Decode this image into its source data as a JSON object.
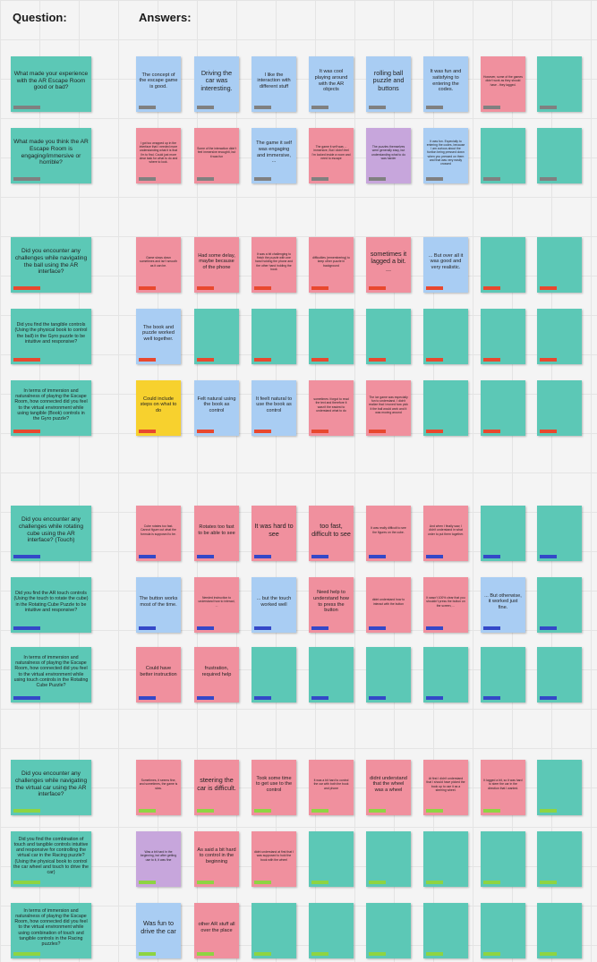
{
  "header": {
    "question": "Question:",
    "answers": "Answers:"
  },
  "rows": [
    {
      "question": "What made your experience with the AR Escape Room good or bad?",
      "qsize": "big",
      "tag": "gray",
      "notes": [
        {
          "c": "blue",
          "t": "The concept of the escape game is good.",
          "s": "m"
        },
        {
          "c": "blue",
          "t": "Driving the car was interesting.",
          "s": "l"
        },
        {
          "c": "blue",
          "t": "I like the interaction with different stuff",
          "s": "m"
        },
        {
          "c": "blue",
          "t": "It was cool playing around with the AR objects",
          "s": "m"
        },
        {
          "c": "blue",
          "t": "rolling ball puzzle and buttons",
          "s": "l"
        },
        {
          "c": "blue",
          "t": "It was fun and satisfying to entering the codes.",
          "s": "m"
        },
        {
          "c": "pink",
          "t": "However, some of the games didn't work as they should have - they lagged.",
          "s": "s"
        },
        {
          "c": "teal",
          "t": "",
          "s": "m"
        }
      ]
    },
    {
      "question": "What made you think the AR Escape Room is engaging/immersive or horrible?",
      "qsize": "big",
      "tag": "gray",
      "notes": [
        {
          "c": "pink",
          "t": "I got too wrapped up in the interface that I needed more understanding what it is that I'm to find. Could just more clear task for what to do and where to look.",
          "s": "s"
        },
        {
          "c": "pink",
          "t": "Some of the interaction didn't feel immersive enoughti, but it was fun",
          "s": "s"
        },
        {
          "c": "blue",
          "t": "The game it self was engaging and immersive, ...",
          "s": "m"
        },
        {
          "c": "pink",
          "t": "The game it self was ... immersive, But I didn't feel I'm locked inside a room and need to escape",
          "s": "s"
        },
        {
          "c": "purple",
          "t": "The puzzles themselves were generally easy, but understanding what to do was harder",
          "s": "s"
        },
        {
          "c": "blue",
          "t": "It was fun. Especially to entering the codes, because I am curious about the funtion being pressed down when you pressed on them and that was very easily crossed",
          "s": "s"
        },
        {
          "c": "teal",
          "t": "",
          "s": "m"
        },
        {
          "c": "teal",
          "t": "",
          "s": "m"
        }
      ]
    },
    {
      "question": "Did you encounter any challenges while navigating the ball using the AR interface?",
      "qsize": "big",
      "tag": "red",
      "notes": [
        {
          "c": "pink",
          "t": "Game slows down sometimes and isn't smooth as it can be.",
          "s": "s"
        },
        {
          "c": "pink",
          "t": "Had some delay, maybe because of the phone",
          "s": "m"
        },
        {
          "c": "pink",
          "t": "It was a bit challenging to finish the puzzle with one hand holding the phone and the other hand holding the book",
          "s": "s"
        },
        {
          "c": "pink",
          "t": "difficulties (remembering) to keep other puzzle in background",
          "s": "s"
        },
        {
          "c": "pink",
          "t": "sometimes it lagged a bit. ...",
          "s": "l"
        },
        {
          "c": "blue",
          "t": "... But over all it was good and very realistic.",
          "s": "m"
        },
        {
          "c": "teal",
          "t": "",
          "s": "m"
        },
        {
          "c": "teal",
          "t": "",
          "s": "m"
        }
      ]
    },
    {
      "question": "Did you find the tangible controls (Using the physical book to control the ball) in the Gyro puzzle to be intuitive and responsive?",
      "qsize": "small",
      "tag": "red",
      "notes": [
        {
          "c": "blue",
          "t": "The book and puzzle worked well together.",
          "s": "m"
        },
        {
          "c": "teal",
          "t": "",
          "s": "m"
        },
        {
          "c": "teal",
          "t": "",
          "s": "m"
        },
        {
          "c": "teal",
          "t": "",
          "s": "m"
        },
        {
          "c": "teal",
          "t": "",
          "s": "m"
        },
        {
          "c": "teal",
          "t": "",
          "s": "m"
        },
        {
          "c": "teal",
          "t": "",
          "s": "m"
        },
        {
          "c": "teal",
          "t": "",
          "s": "m"
        }
      ]
    },
    {
      "question": "In terms of immersion and naturalness of playing the Escape Room, how connected did you feel to the virtual environment while using tangible (Book) controls in the Gyro puzzle?",
      "qsize": "small",
      "tag": "red",
      "notes": [
        {
          "c": "yellow",
          "t": "Could include steps on what to do",
          "s": "m"
        },
        {
          "c": "blue",
          "t": "Felt natural using the book as control",
          "s": "m"
        },
        {
          "c": "blue",
          "t": "It feelt natural to use the book as control",
          "s": "m"
        },
        {
          "c": "pink",
          "t": "sometimes i forgot to read the text and therefore it wasn't the easiest to understand what to do",
          "s": "s"
        },
        {
          "c": "pink",
          "t": "The ice game was especially fun to understand. I didn't realize that I moved how pick it the ball would work and it was moving around",
          "s": "s"
        },
        {
          "c": "teal",
          "t": "",
          "s": "m"
        },
        {
          "c": "teal",
          "t": "",
          "s": "m"
        },
        {
          "c": "teal",
          "t": "",
          "s": "m"
        }
      ]
    },
    {
      "question": "Did you encounter any challenges while rotating cube using the AR interface? (Touch)",
      "qsize": "big",
      "tag": "blue",
      "notes": [
        {
          "c": "pink",
          "t": "Cube rotates too fast. Cannot figure out what the formula is supposed to be.",
          "s": "s"
        },
        {
          "c": "pink",
          "t": "Rotates too fast to be able to see",
          "s": "m"
        },
        {
          "c": "pink",
          "t": "It was hard to see",
          "s": "l"
        },
        {
          "c": "pink",
          "t": "too fast, difficult to see",
          "s": "l"
        },
        {
          "c": "pink",
          "t": "It was really difficult to see the figures on the cube.",
          "s": "s"
        },
        {
          "c": "pink",
          "t": "And when I finally saw, I didn't understand in what order to put them together.",
          "s": "s"
        },
        {
          "c": "teal",
          "t": "",
          "s": "m"
        },
        {
          "c": "teal",
          "t": "",
          "s": "m"
        }
      ]
    },
    {
      "question": "Did you find the AR touch controls (Using the touch to rotate the cube) in the Rotating Cube Puzzle to be intuitive and responsive?",
      "qsize": "small",
      "tag": "blue",
      "notes": [
        {
          "c": "blue",
          "t": "The button works most of the time.",
          "s": "m"
        },
        {
          "c": "pink",
          "t": "Needed instruction to understand how to interact, ...",
          "s": "s"
        },
        {
          "c": "blue",
          "t": "... but the touch worked well",
          "s": "m"
        },
        {
          "c": "pink",
          "t": "Need help to understand how to press the button",
          "s": "m"
        },
        {
          "c": "pink",
          "t": "didnt understand how to interact with the button",
          "s": "s"
        },
        {
          "c": "pink",
          "t": "It wasn't 100% clear that you shouldn't press the button on the screen, ...",
          "s": "s"
        },
        {
          "c": "blue",
          "t": "... But otherwise, it worked just fine.",
          "s": "m"
        },
        {
          "c": "teal",
          "t": "",
          "s": "m"
        }
      ]
    },
    {
      "question": "In terms of immersion and naturalness of playing the Escape Room, how connected did you feel to the virtual environment while using touch controls in the Rotating Cube Puzzle?",
      "qsize": "small",
      "tag": "blue",
      "notes": [
        {
          "c": "pink",
          "t": "Could have better instruction",
          "s": "m"
        },
        {
          "c": "pink",
          "t": "frustration, required help",
          "s": "m"
        },
        {
          "c": "teal",
          "t": "",
          "s": "m"
        },
        {
          "c": "teal",
          "t": "",
          "s": "m"
        },
        {
          "c": "teal",
          "t": "",
          "s": "m"
        },
        {
          "c": "teal",
          "t": "",
          "s": "m"
        },
        {
          "c": "teal",
          "t": "",
          "s": "m"
        },
        {
          "c": "teal",
          "t": "",
          "s": "m"
        }
      ]
    },
    {
      "question": "Did you encounter any challenges while navigating the virtual car using the AR interface?",
      "qsize": "big",
      "tag": "green",
      "notes": [
        {
          "c": "pink",
          "t": "Sometimes, it seems fine, and sometimes, the game is slow.",
          "s": "s"
        },
        {
          "c": "pink",
          "t": "steering the car is difficult.",
          "s": "l"
        },
        {
          "c": "pink",
          "t": "Took some time to get use to the control",
          "s": "m"
        },
        {
          "c": "pink",
          "t": "It was a bit hard to control the car with both the book and phone",
          "s": "s"
        },
        {
          "c": "pink",
          "t": "didnt understand that the wheel was a wheel",
          "s": "m"
        },
        {
          "c": "pink",
          "t": "At first I didn't understand that I should have picked the book up to use it as a steering wheel.",
          "s": "s"
        },
        {
          "c": "pink",
          "t": "It lagged a bit, so it was hard to steer the car in the direction that I wanted.",
          "s": "s"
        },
        {
          "c": "teal",
          "t": "",
          "s": "m"
        }
      ]
    },
    {
      "question": "Did you find the combination of touch and tangible controls intuitive and responsive for controlling the virtual car in the Racing puzzle? (Using the physical book to control the car wheel and touch to drive the car)",
      "qsize": "small",
      "tag": "green",
      "notes": [
        {
          "c": "purple",
          "t": "Was a bit hard in the beginning, but after getting use to it, it was fine",
          "s": "s"
        },
        {
          "c": "pink",
          "t": "As said a bit hard to control in the beginning",
          "s": "m"
        },
        {
          "c": "pink",
          "t": "didnt understand at first that I was supposed to hold the book with the wheel",
          "s": "s"
        },
        {
          "c": "teal",
          "t": "",
          "s": "m"
        },
        {
          "c": "teal",
          "t": "",
          "s": "m"
        },
        {
          "c": "teal",
          "t": "",
          "s": "m"
        },
        {
          "c": "teal",
          "t": "",
          "s": "m"
        },
        {
          "c": "teal",
          "t": "",
          "s": "m"
        }
      ]
    },
    {
      "question": "In terms of immersion and naturalness of playing the Escape Room, how connected did you feel to the virtual environment while using combination of touch and tangible controls in the Racing puzzles?",
      "qsize": "small",
      "tag": "green",
      "notes": [
        {
          "c": "blue",
          "t": "Was fun to drive the car",
          "s": "l"
        },
        {
          "c": "pink",
          "t": "other AR stuff all over the place",
          "s": "m"
        },
        {
          "c": "teal",
          "t": "",
          "s": "m"
        },
        {
          "c": "teal",
          "t": "",
          "s": "m"
        },
        {
          "c": "teal",
          "t": "",
          "s": "m"
        },
        {
          "c": "teal",
          "t": "",
          "s": "m"
        },
        {
          "c": "teal",
          "t": "",
          "s": "m"
        },
        {
          "c": "teal",
          "t": "",
          "s": "m"
        }
      ]
    }
  ]
}
